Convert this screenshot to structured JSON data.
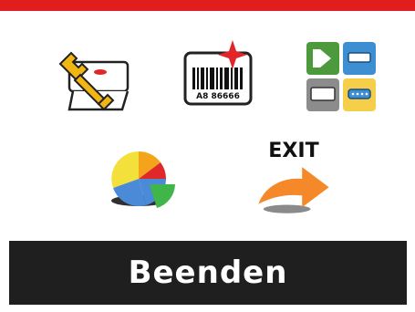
{
  "status": {
    "label": "Beenden"
  },
  "menu": {
    "items": [
      {
        "icon": "settings-wrench-icon"
      },
      {
        "icon": "barcode-label-icon",
        "barcode_text": "A8 86666"
      },
      {
        "icon": "interfaces-icon"
      },
      {
        "icon": "pie-chart-icon"
      },
      {
        "icon": "exit-arrow-icon",
        "label": "EXIT"
      }
    ]
  },
  "colors": {
    "top_bar": "#e21d1d",
    "status_bar": "#1f1f1f",
    "exit_arrow": "#f5892a"
  }
}
